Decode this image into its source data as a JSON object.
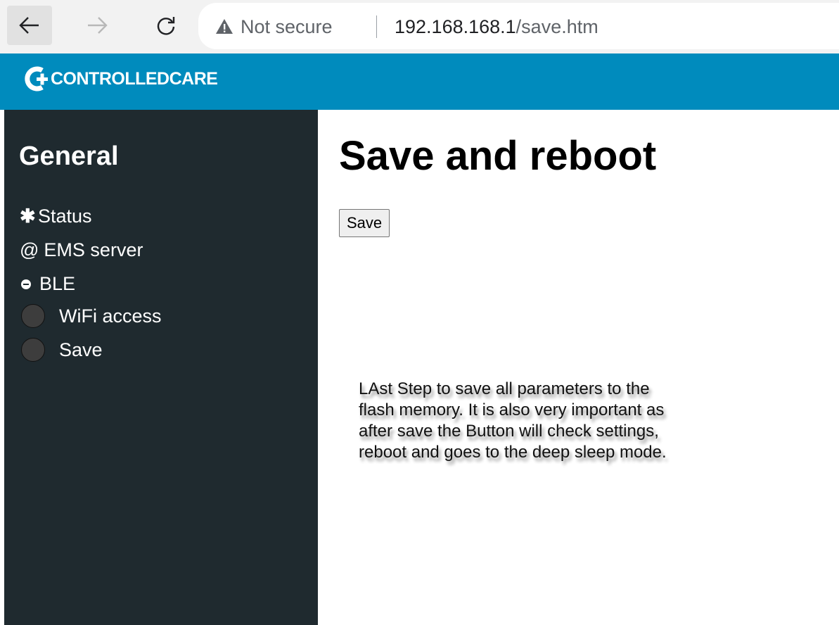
{
  "browser": {
    "back_icon": "arrow-left-icon",
    "forward_icon": "arrow-right-icon",
    "reload_icon": "reload-icon",
    "security_label": "Not secure",
    "url_host": "192.168.168.1",
    "url_path": "/save.htm"
  },
  "header": {
    "logo_text": "CONTROLLEDCARE",
    "background_color": "#008bbd"
  },
  "sidebar": {
    "title": "General",
    "background_color": "#1f2a2f",
    "items": [
      {
        "icon": "asterisk-icon",
        "glyph": "✱",
        "label": "Status"
      },
      {
        "icon": "at-icon",
        "glyph": "@",
        "label": "EMS server"
      },
      {
        "icon": "ble-dot-icon",
        "glyph": "",
        "label": "BLE"
      },
      {
        "icon": "circle-icon",
        "glyph": "",
        "label": "WiFi access"
      },
      {
        "icon": "circle-icon",
        "glyph": "",
        "label": "Save"
      }
    ]
  },
  "main": {
    "title": "Save and reboot",
    "save_button_label": "Save",
    "note_lines": [
      "LAst Step to save all parameters to the",
      "flash memory. It is also very important as",
      "after save the Button will check settings,",
      "reboot and goes to the deep sleep mode."
    ]
  }
}
